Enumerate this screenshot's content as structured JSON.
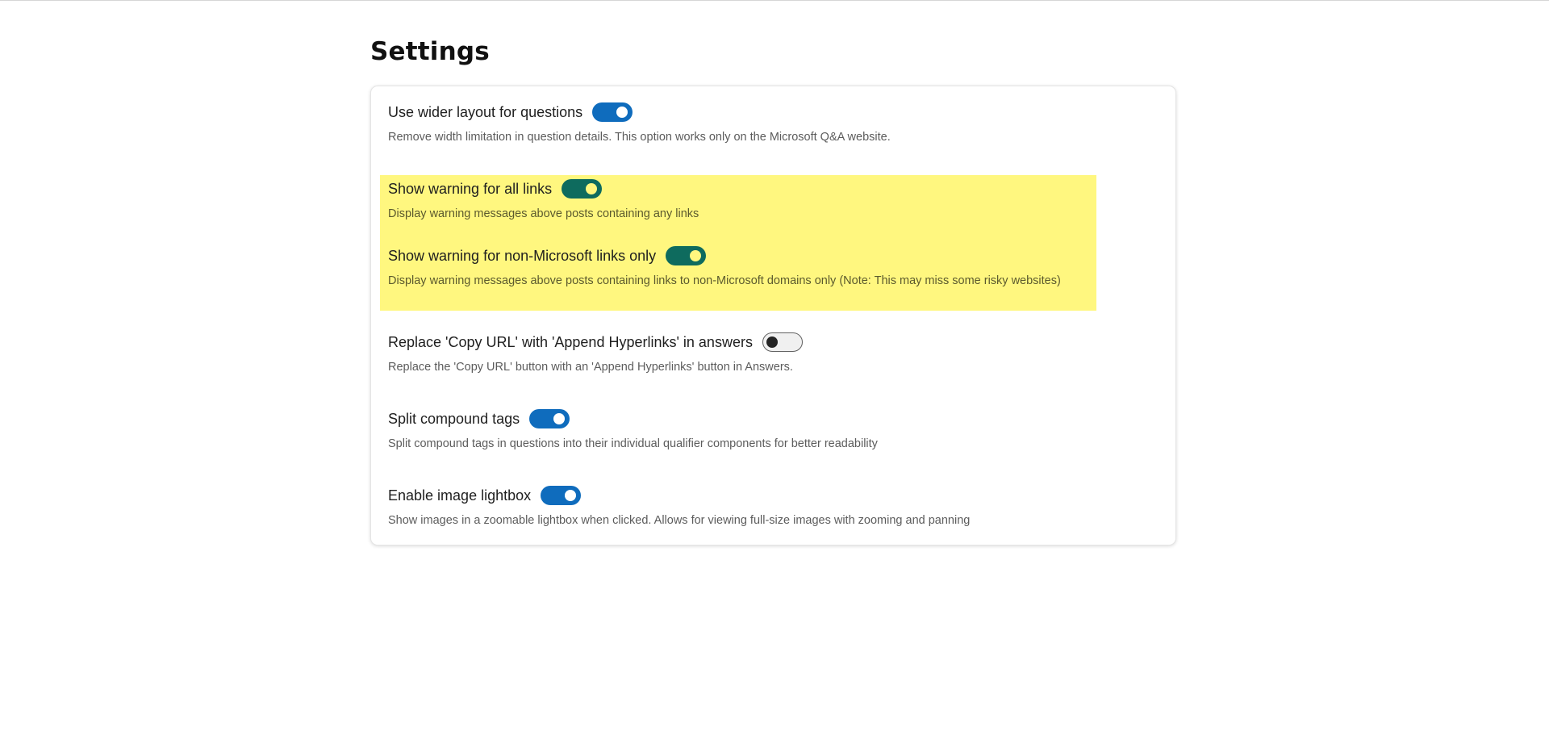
{
  "page": {
    "title": "Settings"
  },
  "colors": {
    "accent": "#0f6cbd",
    "accent_on_highlight": "#0e6b5e",
    "highlight": "#fff77f"
  },
  "settings": [
    {
      "label": "Use wider layout for questions",
      "description": "Remove width limitation in question details. This option works only on the Microsoft Q&A website.",
      "enabled": true,
      "highlighted": false
    },
    {
      "label": "Show warning for all links",
      "description": "Display warning messages above posts containing any links",
      "enabled": true,
      "highlighted": true
    },
    {
      "label": "Show warning for non-Microsoft links only",
      "description": "Display warning messages above posts containing links to non-Microsoft domains only (Note: This may miss some risky websites)",
      "enabled": true,
      "highlighted": true
    },
    {
      "label": "Replace 'Copy URL' with 'Append Hyperlinks' in answers",
      "description": "Replace the 'Copy URL' button with an 'Append Hyperlinks' button in Answers.",
      "enabled": false,
      "highlighted": false
    },
    {
      "label": "Split compound tags",
      "description": "Split compound tags in questions into their individual qualifier components for better readability",
      "enabled": true,
      "highlighted": false
    },
    {
      "label": "Enable image lightbox",
      "description": "Show images in a zoomable lightbox when clicked. Allows for viewing full-size images with zooming and panning",
      "enabled": true,
      "highlighted": false
    }
  ]
}
